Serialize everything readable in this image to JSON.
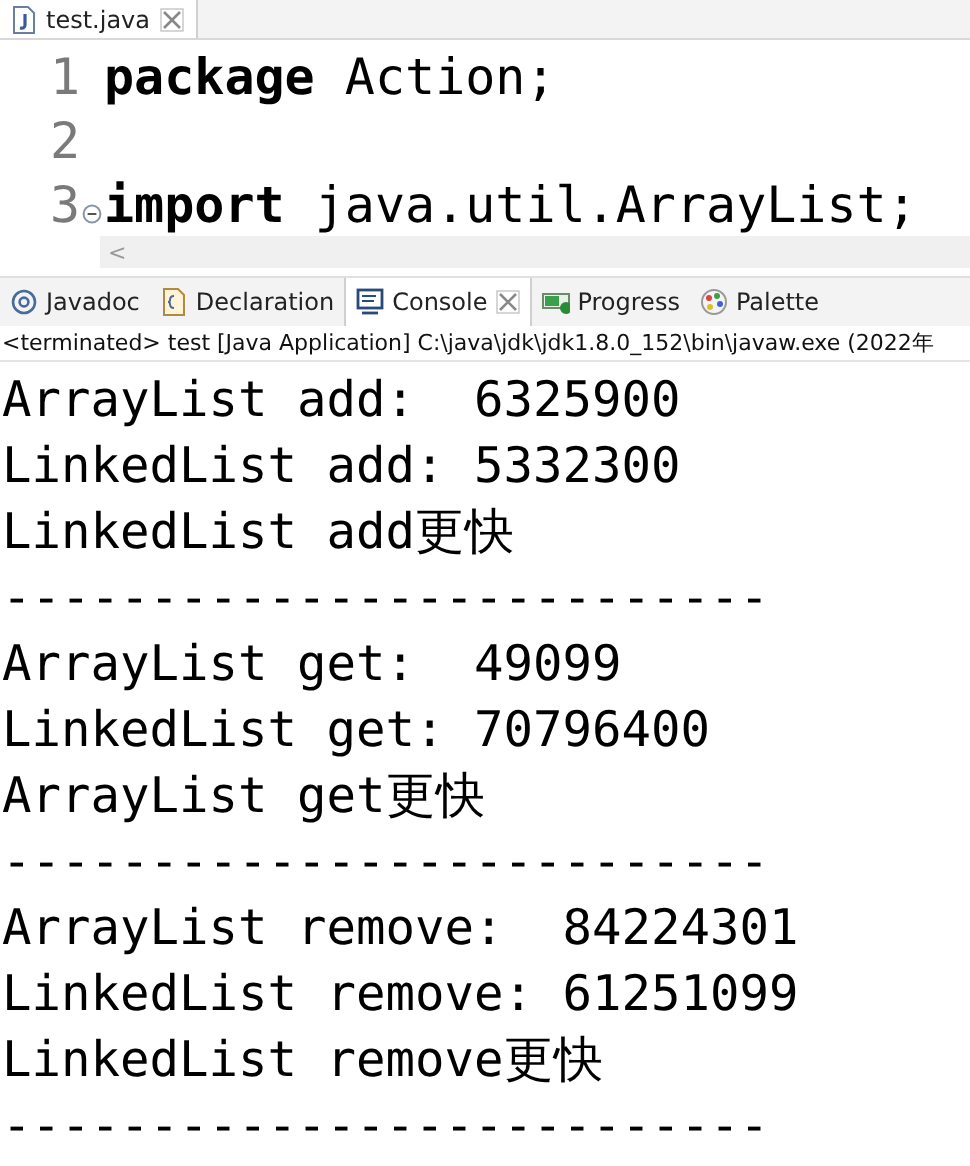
{
  "editor": {
    "tab": {
      "label": "test.java",
      "selected": true
    },
    "lines": [
      {
        "number": "1",
        "code": "**package** Action;",
        "foldable": false
      },
      {
        "number": "2",
        "foldable": false
      },
      {
        "number": "3",
        "code": "**import** java.util.ArrayList;",
        "foldable": true
      }
    ],
    "scroll_arrow": "<"
  },
  "views": {
    "tabs": [
      {
        "label": "Javadoc",
        "selected": false
      },
      {
        "label": "Declaration",
        "selected": false
      },
      {
        "label": "Console",
        "selected": true
      },
      {
        "label": "Progress",
        "selected": false
      },
      {
        "label": "Palette",
        "selected": false
      }
    ]
  },
  "console": {
    "status": "<terminated> test [Java Application] C:\\java\\jdk\\jdk1.8.0_152\\bin\\javaw.exe  (2022年",
    "output": [
      "ArrayList add:  6325900",
      "LinkedList add: 5332300",
      "LinkedList add更快",
      "--------------------------",
      "ArrayList get:  49099",
      "LinkedList get: 70796400",
      "ArrayList get更快",
      "--------------------------",
      "ArrayList remove:  84224301",
      "LinkedList remove: 61251099",
      "LinkedList remove更快",
      "--------------------------"
    ]
  }
}
